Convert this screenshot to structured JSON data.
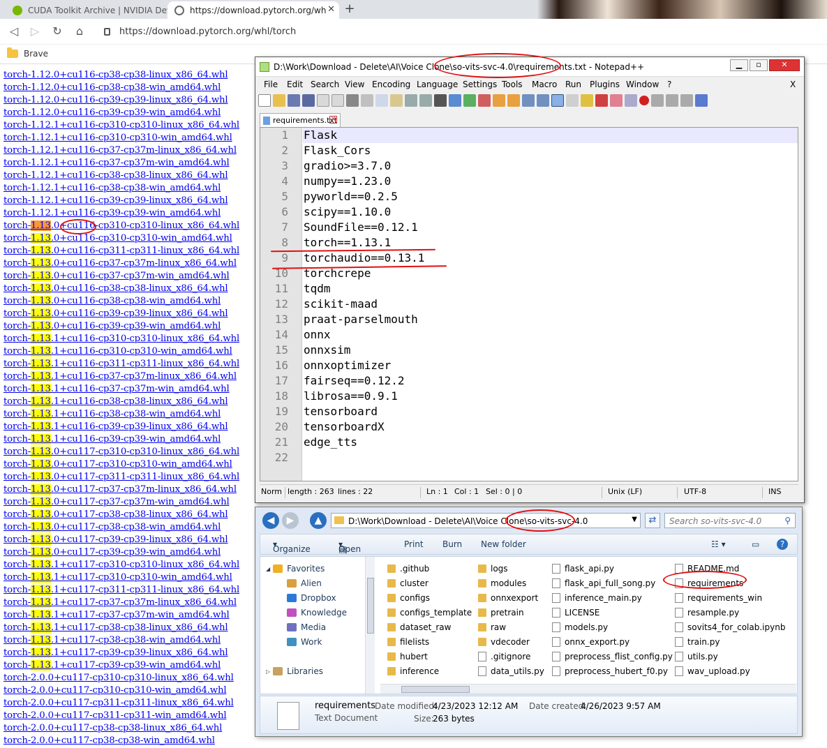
{
  "browser": {
    "tabs": [
      {
        "label": "CUDA Toolkit Archive | NVIDIA Develo"
      },
      {
        "label": "https://download.pytorch.org/wh"
      }
    ],
    "url": "https://download.pytorch.org/whl/torch",
    "bookmark": "Brave"
  },
  "links": [
    {
      "pre": "torch-",
      "hl": "",
      "post": "1.12.0+cu116-cp38-cp38-linux_x86_64.whl"
    },
    {
      "pre": "torch-",
      "hl": "",
      "post": "1.12.0+cu116-cp38-cp38-win_amd64.whl"
    },
    {
      "pre": "torch-",
      "hl": "",
      "post": "1.12.0+cu116-cp39-cp39-linux_x86_64.whl"
    },
    {
      "pre": "torch-",
      "hl": "",
      "post": "1.12.0+cu116-cp39-cp39-win_amd64.whl"
    },
    {
      "pre": "torch-",
      "hl": "",
      "post": "1.12.1+cu116-cp310-cp310-linux_x86_64.whl"
    },
    {
      "pre": "torch-",
      "hl": "",
      "post": "1.12.1+cu116-cp310-cp310-win_amd64.whl"
    },
    {
      "pre": "torch-",
      "hl": "",
      "post": "1.12.1+cu116-cp37-cp37m-linux_x86_64.whl"
    },
    {
      "pre": "torch-",
      "hl": "",
      "post": "1.12.1+cu116-cp37-cp37m-win_amd64.whl"
    },
    {
      "pre": "torch-",
      "hl": "",
      "post": "1.12.1+cu116-cp38-cp38-linux_x86_64.whl"
    },
    {
      "pre": "torch-",
      "hl": "",
      "post": "1.12.1+cu116-cp38-cp38-win_amd64.whl"
    },
    {
      "pre": "torch-",
      "hl": "",
      "post": "1.12.1+cu116-cp39-cp39-linux_x86_64.whl"
    },
    {
      "pre": "torch-",
      "hl": "",
      "post": "1.12.1+cu116-cp39-cp39-win_amd64.whl"
    },
    {
      "pre": "torch-",
      "hl": "1.13",
      "post": ".0+cu116-cp310-cp310-linux_x86_64.whl"
    },
    {
      "pre": "torch-",
      "hl": "1.13",
      "post": ".0+cu116-cp310-cp310-win_amd64.whl"
    },
    {
      "pre": "torch-",
      "hl": "1.13",
      "post": ".0+cu116-cp311-cp311-linux_x86_64.whl"
    },
    {
      "pre": "torch-",
      "hl": "1.13",
      "post": ".0+cu116-cp37-cp37m-linux_x86_64.whl"
    },
    {
      "pre": "torch-",
      "hl": "1.13",
      "post": ".0+cu116-cp37-cp37m-win_amd64.whl"
    },
    {
      "pre": "torch-",
      "hl": "1.13",
      "post": ".0+cu116-cp38-cp38-linux_x86_64.whl"
    },
    {
      "pre": "torch-",
      "hl": "1.13",
      "post": ".0+cu116-cp38-cp38-win_amd64.whl"
    },
    {
      "pre": "torch-",
      "hl": "1.13",
      "post": ".0+cu116-cp39-cp39-linux_x86_64.whl"
    },
    {
      "pre": "torch-",
      "hl": "1.13",
      "post": ".0+cu116-cp39-cp39-win_amd64.whl"
    },
    {
      "pre": "torch-",
      "hl": "1.13",
      "post": ".1+cu116-cp310-cp310-linux_x86_64.whl"
    },
    {
      "pre": "torch-",
      "hl": "1.13",
      "post": ".1+cu116-cp310-cp310-win_amd64.whl"
    },
    {
      "pre": "torch-",
      "hl": "1.13",
      "post": ".1+cu116-cp311-cp311-linux_x86_64.whl"
    },
    {
      "pre": "torch-",
      "hl": "1.13",
      "post": ".1+cu116-cp37-cp37m-linux_x86_64.whl"
    },
    {
      "pre": "torch-",
      "hl": "1.13",
      "post": ".1+cu116-cp37-cp37m-win_amd64.whl"
    },
    {
      "pre": "torch-",
      "hl": "1.13",
      "post": ".1+cu116-cp38-cp38-linux_x86_64.whl"
    },
    {
      "pre": "torch-",
      "hl": "1.13",
      "post": ".1+cu116-cp38-cp38-win_amd64.whl"
    },
    {
      "pre": "torch-",
      "hl": "1.13",
      "post": ".1+cu116-cp39-cp39-linux_x86_64.whl"
    },
    {
      "pre": "torch-",
      "hl": "1.13",
      "post": ".1+cu116-cp39-cp39-win_amd64.whl"
    },
    {
      "pre": "torch-",
      "hl": "1.13",
      "post": ".0+cu117-cp310-cp310-linux_x86_64.whl"
    },
    {
      "pre": "torch-",
      "hl": "1.13",
      "post": ".0+cu117-cp310-cp310-win_amd64.whl"
    },
    {
      "pre": "torch-",
      "hl": "1.13",
      "post": ".0+cu117-cp311-cp311-linux_x86_64.whl"
    },
    {
      "pre": "torch-",
      "hl": "1.13",
      "post": ".0+cu117-cp37-cp37m-linux_x86_64.whl"
    },
    {
      "pre": "torch-",
      "hl": "1.13",
      "post": ".0+cu117-cp37-cp37m-win_amd64.whl"
    },
    {
      "pre": "torch-",
      "hl": "1.13",
      "post": ".0+cu117-cp38-cp38-linux_x86_64.whl"
    },
    {
      "pre": "torch-",
      "hl": "1.13",
      "post": ".0+cu117-cp38-cp38-win_amd64.whl"
    },
    {
      "pre": "torch-",
      "hl": "1.13",
      "post": ".0+cu117-cp39-cp39-linux_x86_64.whl"
    },
    {
      "pre": "torch-",
      "hl": "1.13",
      "post": ".0+cu117-cp39-cp39-win_amd64.whl"
    },
    {
      "pre": "torch-",
      "hl": "1.13",
      "post": ".1+cu117-cp310-cp310-linux_x86_64.whl"
    },
    {
      "pre": "torch-",
      "hl": "1.13",
      "post": ".1+cu117-cp310-cp310-win_amd64.whl"
    },
    {
      "pre": "torch-",
      "hl": "1.13",
      "post": ".1+cu117-cp311-cp311-linux_x86_64.whl"
    },
    {
      "pre": "torch-",
      "hl": "1.13",
      "post": ".1+cu117-cp37-cp37m-linux_x86_64.whl"
    },
    {
      "pre": "torch-",
      "hl": "1.13",
      "post": ".1+cu117-cp37-cp37m-win_amd64.whl"
    },
    {
      "pre": "torch-",
      "hl": "1.13",
      "post": ".1+cu117-cp38-cp38-linux_x86_64.whl"
    },
    {
      "pre": "torch-",
      "hl": "1.13",
      "post": ".1+cu117-cp38-cp38-win_amd64.whl"
    },
    {
      "pre": "torch-",
      "hl": "1.13",
      "post": ".1+cu117-cp39-cp39-linux_x86_64.whl"
    },
    {
      "pre": "torch-",
      "hl": "1.13",
      "post": ".1+cu117-cp39-cp39-win_amd64.whl"
    },
    {
      "pre": "torch-",
      "hl": "",
      "post": "2.0.0+cu117-cp310-cp310-linux_x86_64.whl"
    },
    {
      "pre": "torch-",
      "hl": "",
      "post": "2.0.0+cu117-cp310-cp310-win_amd64.whl"
    },
    {
      "pre": "torch-",
      "hl": "",
      "post": "2.0.0+cu117-cp311-cp311-linux_x86_64.whl"
    },
    {
      "pre": "torch-",
      "hl": "",
      "post": "2.0.0+cu117-cp311-cp311-win_amd64.whl"
    },
    {
      "pre": "torch-",
      "hl": "",
      "post": "2.0.0+cu117-cp38-cp38-linux_x86_64.whl"
    },
    {
      "pre": "torch-",
      "hl": "",
      "post": "2.0.0+cu117-cp38-cp38-win_amd64.whl"
    }
  ],
  "notepad": {
    "title": "D:\\Work\\Download - Delete\\AI\\Voice Clone\\so-vits-svc-4.0\\requirements.txt - Notepad++",
    "menu": [
      "File",
      "Edit",
      "Search",
      "View",
      "Encoding",
      "Language",
      "Settings",
      "Tools",
      "Macro",
      "Run",
      "Plugins",
      "Window",
      "?",
      "X"
    ],
    "tab": "requirements.txt",
    "lines": [
      "Flask",
      "Flask_Cors",
      "gradio>=3.7.0",
      "numpy==1.23.0",
      "pyworld==0.2.5",
      "scipy==1.10.0",
      "SoundFile==0.12.1",
      "torch==1.13.1",
      "torchaudio==0.13.1",
      "torchcrepe",
      "tqdm",
      "scikit-maad",
      "praat-parselmouth",
      "onnx",
      "onnxsim",
      "onnxoptimizer",
      "fairseq==0.12.2",
      "librosa==0.9.1",
      "tensorboard",
      "tensorboardX",
      "edge_tts",
      ""
    ],
    "status": {
      "type": "Norm",
      "length": "length : 263",
      "lines": "lines : 22",
      "ln": "Ln : 1",
      "col": "Col : 1",
      "sel": "Sel : 0 | 0",
      "eol": "Unix (LF)",
      "enc": "UTF-8",
      "mode": "INS"
    }
  },
  "explorer": {
    "path": "D:\\Work\\Download - Delete\\AI\\Voice Clone\\so-vits-svc-4.0",
    "search_placeholder": "Search so-vits-svc-4.0",
    "cmd": [
      "Organize",
      "Open",
      "Print",
      "Burn",
      "New folder"
    ],
    "nav": [
      {
        "label": "Favorites",
        "color": "#f0b020"
      },
      {
        "label": "Alien",
        "color": "#d9a040"
      },
      {
        "label": "Dropbox",
        "color": "#2b7bd6"
      },
      {
        "label": "Knowledge",
        "color": "#c050c0"
      },
      {
        "label": "Media",
        "color": "#7070c0"
      },
      {
        "label": "Work",
        "color": "#4090c0"
      },
      {
        "label": "Libraries",
        "color": "#c8a060"
      }
    ],
    "col1": [
      ".github",
      "cluster",
      "configs",
      "configs_template",
      "dataset_raw",
      "filelists",
      "hubert",
      "inference"
    ],
    "col2": [
      "logs",
      "modules",
      "onnxexport",
      "pretrain",
      "raw",
      "vdecoder",
      ".gitignore",
      "data_utils.py"
    ],
    "col3": [
      "flask_api.py",
      "flask_api_full_song.py",
      "inference_main.py",
      "LICENSE",
      "models.py",
      "onnx_export.py",
      "preprocess_flist_config.py",
      "preprocess_hubert_f0.py"
    ],
    "col4": [
      "README.md",
      "requirements",
      "requirements_win",
      "resample.py",
      "sovits4_for_colab.ipynb",
      "train.py",
      "utils.py",
      "wav_upload.py"
    ],
    "details": {
      "name": "requirements",
      "type": "Text Document",
      "modified_label": "Date modified:",
      "modified": "4/23/2023 12:12 AM",
      "created_label": "Date created:",
      "created": "4/26/2023 9:57 AM",
      "size_label": "Size:",
      "size": "263 bytes"
    }
  }
}
